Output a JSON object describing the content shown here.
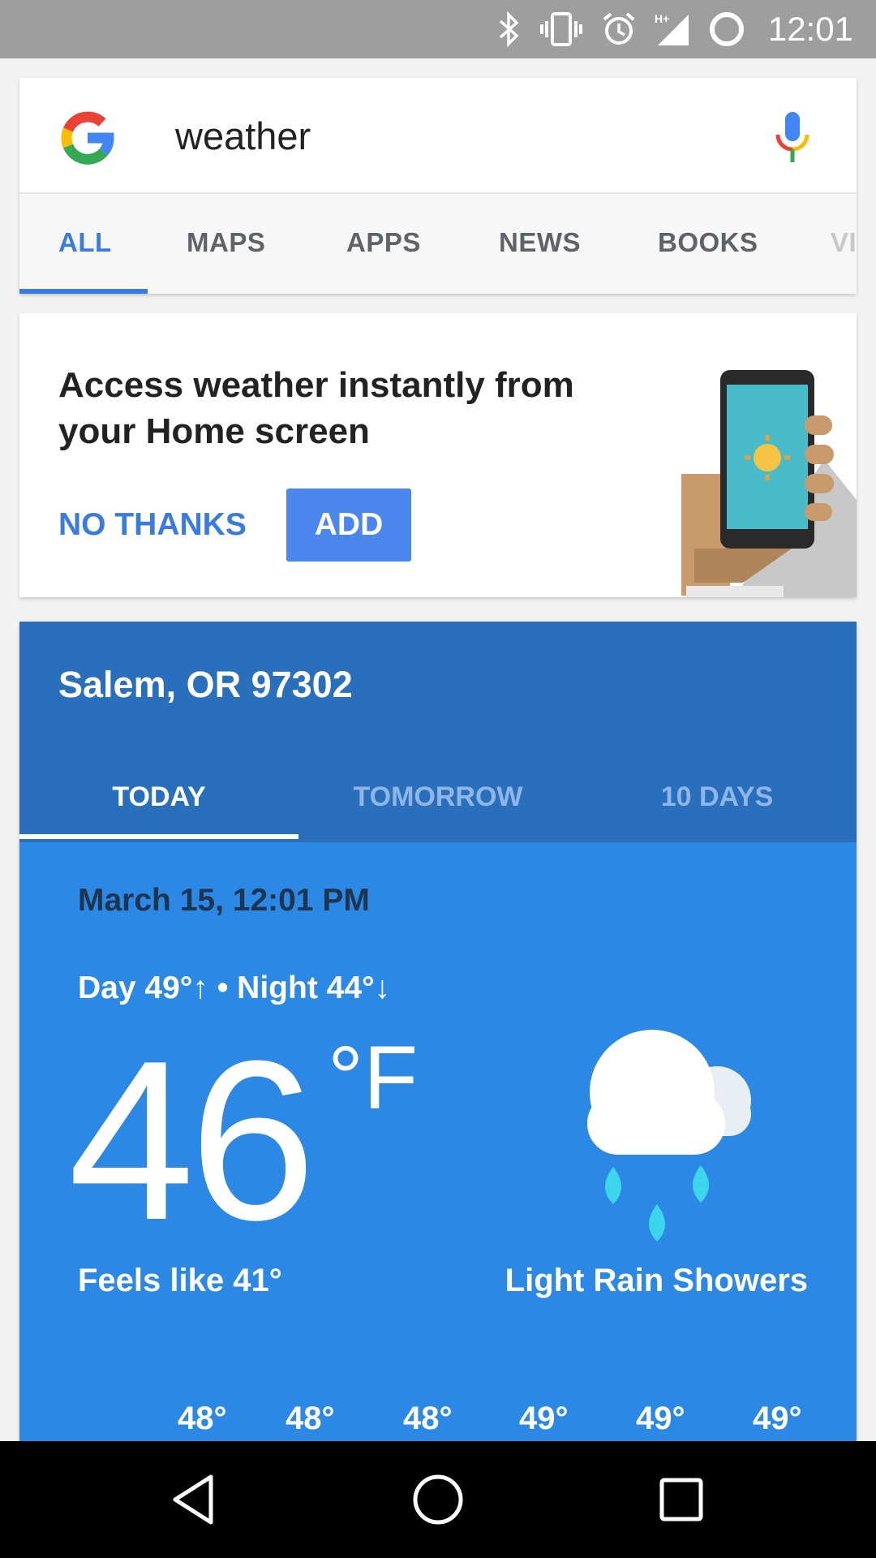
{
  "status_bar": {
    "time": "12:01",
    "icons": [
      "bluetooth-icon",
      "vibrate-icon",
      "alarm-icon",
      "signal-hplus-icon",
      "battery-ring-icon"
    ],
    "background": "#9e9e9e"
  },
  "search": {
    "query": "weather",
    "tabs": [
      "ALL",
      "MAPS",
      "APPS",
      "NEWS",
      "BOOKS",
      "VI"
    ],
    "active_tab": "ALL",
    "accent": "#3a7be0"
  },
  "promo": {
    "title": "Access weather instantly from your Home screen",
    "dismiss_label": "NO THANKS",
    "add_label": "ADD"
  },
  "weather": {
    "location": "Salem, OR 97302",
    "tabs": [
      "TODAY",
      "TOMORROW",
      "10 DAYS"
    ],
    "active_tab": "TODAY",
    "datetime": "March 15, 12:01 PM",
    "day_night": "Day 49°↑ • Night 44°↓",
    "temperature": "46",
    "unit": "°F",
    "feels_like": "Feels like 41°",
    "condition": "Light Rain Showers",
    "hourly_temps": [
      "48°",
      "48°",
      "48°",
      "49°",
      "49°",
      "49°"
    ],
    "icon": "rain-showers-icon",
    "header_color": "#2a6fbc",
    "body_color": "#2b88e5"
  },
  "nav": {
    "buttons": [
      "back-icon",
      "home-icon",
      "recents-icon"
    ]
  }
}
